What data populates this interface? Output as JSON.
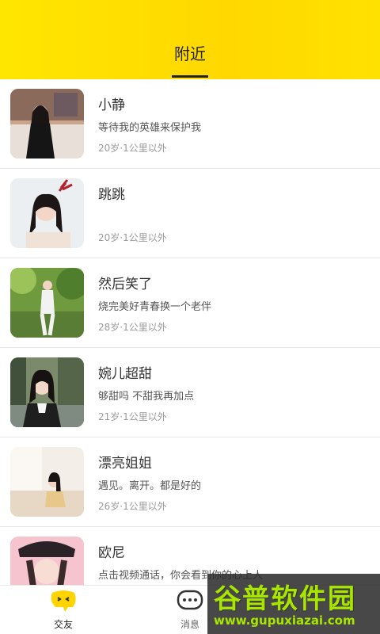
{
  "header": {
    "title": "附近"
  },
  "users": [
    {
      "name": "小静",
      "signature": "等待我的英雄来保护我",
      "meta": "20岁·1公里以外"
    },
    {
      "name": "跳跳",
      "signature": "",
      "meta": "20岁·1公里以外"
    },
    {
      "name": "然后笑了",
      "signature": "烧完美好青春换一个老伴",
      "meta": "28岁·1公里以外"
    },
    {
      "name": "婉儿超甜",
      "signature": "够甜吗 不甜我再加点",
      "meta": "21岁·1公里以外"
    },
    {
      "name": "漂亮姐姐",
      "signature": "遇见。离开。都是好的",
      "meta": "26岁·1公里以外"
    },
    {
      "name": "欧尼",
      "signature": "点击视频通话，你会看到你的心上人",
      "meta": ""
    }
  ],
  "tabbar": {
    "tabs": [
      {
        "label": "交友",
        "icon": "face-bubble-icon",
        "active": true
      },
      {
        "label": "消息",
        "icon": "chat-bubble-icon",
        "active": false
      }
    ]
  },
  "watermark": {
    "title": "谷普软件园",
    "url": "www.gupuxiazai.com"
  },
  "colors": {
    "accent": "#ffe000",
    "text": "#333333",
    "muted": "#9a9a9a"
  }
}
